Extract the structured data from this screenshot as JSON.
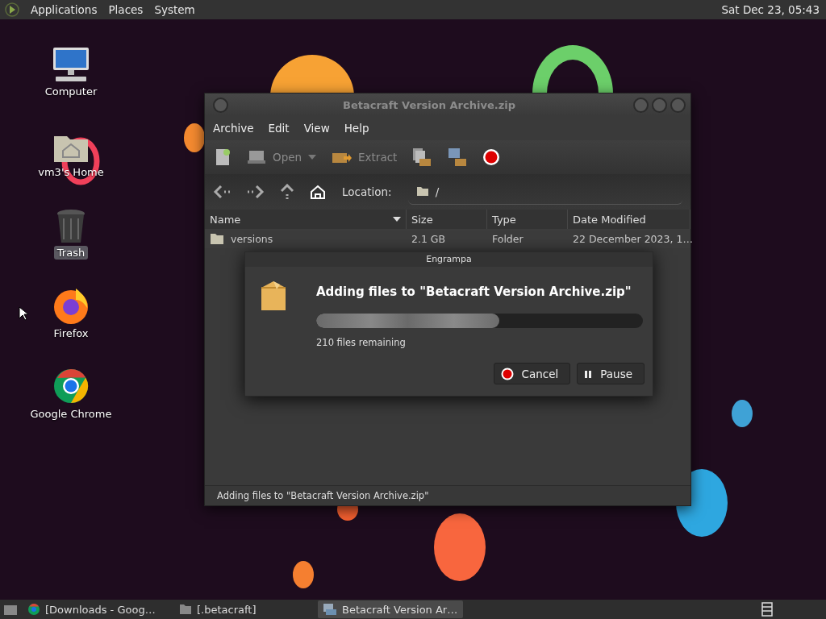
{
  "top_panel": {
    "menus": [
      "Applications",
      "Places",
      "System"
    ],
    "clock": "Sat Dec 23, 05:43"
  },
  "desktop_icons": [
    {
      "label": "Computer",
      "kind": "computer",
      "selected": false
    },
    {
      "label": "vm3's Home",
      "kind": "home",
      "selected": false
    },
    {
      "label": "Trash",
      "kind": "trash",
      "selected": true
    },
    {
      "label": "Firefox",
      "kind": "firefox",
      "selected": false
    },
    {
      "label": "Google Chrome",
      "kind": "chrome",
      "selected": false
    }
  ],
  "window": {
    "title": "Betacraft Version Archive.zip",
    "menu": [
      "Archive",
      "Edit",
      "View",
      "Help"
    ],
    "toolbar": [
      {
        "kind": "new"
      },
      {
        "kind": "open",
        "label": "Open",
        "disabled": true
      },
      {
        "kind": "extract",
        "label": "Extract",
        "disabled": true
      },
      {
        "kind": "add_files"
      },
      {
        "kind": "add_folder"
      },
      {
        "kind": "stop"
      }
    ],
    "location": {
      "label": "Location:",
      "value": "/"
    },
    "columns": [
      "Name",
      "Size",
      "Type",
      "Date Modified"
    ],
    "rows": [
      {
        "name": "versions",
        "size": "2.1 GB",
        "type": "Folder",
        "date": "22 December 2023, 1…"
      }
    ],
    "status": "Adding files to \"Betacraft Version Archive.zip\""
  },
  "dialog": {
    "title": "Engrampa",
    "heading": "Adding files to \"Betacraft Version Archive.zip\"",
    "level": 0.56,
    "remaining": "210 files remaining",
    "buttons": [
      {
        "kind": "cancel",
        "label": "Cancel"
      },
      {
        "kind": "pause",
        "label": "Pause"
      }
    ]
  },
  "taskbar": {
    "items": [
      {
        "label": "[Downloads - Goog…",
        "kind": "browser",
        "selected": false
      },
      {
        "label": "[.betacraft]",
        "kind": "folder",
        "selected": false
      },
      {
        "label": "Betacraft Version Ar…",
        "kind": "archive",
        "selected": true
      }
    ]
  }
}
